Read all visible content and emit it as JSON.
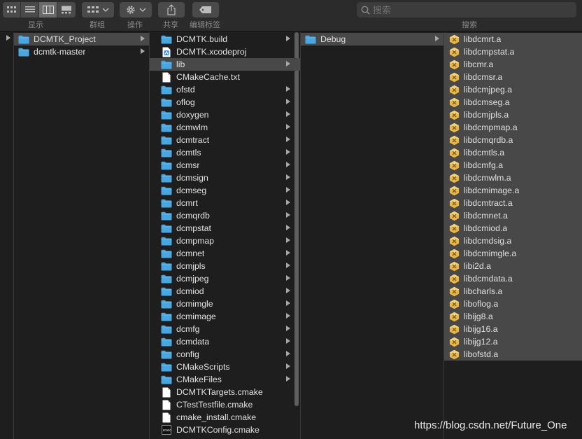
{
  "toolbar": {
    "view_label": "显示",
    "group_label": "群组",
    "action_label": "操作",
    "share_label": "共享",
    "tags_label": "编辑标签",
    "search_label": "搜索",
    "search_placeholder": "搜索"
  },
  "columns": [
    {
      "items": [
        {
          "label": "DCMTK_Project",
          "type": "folder",
          "selected": true,
          "chevron": true
        },
        {
          "label": "dcmtk-master",
          "type": "folder",
          "selected": false,
          "chevron": true
        }
      ]
    },
    {
      "items": [
        {
          "label": "DCMTK.build",
          "type": "folder",
          "selected": false,
          "chevron": true
        },
        {
          "label": "DCMTK.xcodeproj",
          "type": "xcodeproj",
          "selected": false,
          "chevron": false
        },
        {
          "label": "lib",
          "type": "folder",
          "selected": true,
          "chevron": true
        },
        {
          "label": "CMakeCache.txt",
          "type": "file",
          "selected": false,
          "chevron": false
        },
        {
          "label": "ofstd",
          "type": "folder",
          "selected": false,
          "chevron": true
        },
        {
          "label": "oflog",
          "type": "folder",
          "selected": false,
          "chevron": true
        },
        {
          "label": "doxygen",
          "type": "folder",
          "selected": false,
          "chevron": true
        },
        {
          "label": "dcmwlm",
          "type": "folder",
          "selected": false,
          "chevron": true
        },
        {
          "label": "dcmtract",
          "type": "folder",
          "selected": false,
          "chevron": true
        },
        {
          "label": "dcmtls",
          "type": "folder",
          "selected": false,
          "chevron": true
        },
        {
          "label": "dcmsr",
          "type": "folder",
          "selected": false,
          "chevron": true
        },
        {
          "label": "dcmsign",
          "type": "folder",
          "selected": false,
          "chevron": true
        },
        {
          "label": "dcmseg",
          "type": "folder",
          "selected": false,
          "chevron": true
        },
        {
          "label": "dcmrt",
          "type": "folder",
          "selected": false,
          "chevron": true
        },
        {
          "label": "dcmqrdb",
          "type": "folder",
          "selected": false,
          "chevron": true
        },
        {
          "label": "dcmpstat",
          "type": "folder",
          "selected": false,
          "chevron": true
        },
        {
          "label": "dcmpmap",
          "type": "folder",
          "selected": false,
          "chevron": true
        },
        {
          "label": "dcmnet",
          "type": "folder",
          "selected": false,
          "chevron": true
        },
        {
          "label": "dcmjpls",
          "type": "folder",
          "selected": false,
          "chevron": true
        },
        {
          "label": "dcmjpeg",
          "type": "folder",
          "selected": false,
          "chevron": true
        },
        {
          "label": "dcmiod",
          "type": "folder",
          "selected": false,
          "chevron": true
        },
        {
          "label": "dcmimgle",
          "type": "folder",
          "selected": false,
          "chevron": true
        },
        {
          "label": "dcmimage",
          "type": "folder",
          "selected": false,
          "chevron": true
        },
        {
          "label": "dcmfg",
          "type": "folder",
          "selected": false,
          "chevron": true
        },
        {
          "label": "dcmdata",
          "type": "folder",
          "selected": false,
          "chevron": true
        },
        {
          "label": "config",
          "type": "folder",
          "selected": false,
          "chevron": true
        },
        {
          "label": "CMakeScripts",
          "type": "folder",
          "selected": false,
          "chevron": true
        },
        {
          "label": "CMakeFiles",
          "type": "folder",
          "selected": false,
          "chevron": true
        },
        {
          "label": "DCMTKTargets.cmake",
          "type": "file",
          "selected": false,
          "chevron": false
        },
        {
          "label": "CTestTestfile.cmake",
          "type": "file",
          "selected": false,
          "chevron": false
        },
        {
          "label": "cmake_install.cmake",
          "type": "file",
          "selected": false,
          "chevron": false
        },
        {
          "label": "DCMTKConfig.cmake",
          "type": "exec",
          "selected": false,
          "chevron": false
        }
      ]
    },
    {
      "items": [
        {
          "label": "Debug",
          "type": "folder",
          "selected": true,
          "chevron": true
        }
      ]
    },
    {
      "items": [
        {
          "label": "libdcmrt.a",
          "type": "lib",
          "selected": true,
          "chevron": false
        },
        {
          "label": "libdcmpstat.a",
          "type": "lib",
          "selected": true,
          "chevron": false
        },
        {
          "label": "libcmr.a",
          "type": "lib",
          "selected": true,
          "chevron": false
        },
        {
          "label": "libdcmsr.a",
          "type": "lib",
          "selected": true,
          "chevron": false
        },
        {
          "label": "libdcmjpeg.a",
          "type": "lib",
          "selected": true,
          "chevron": false
        },
        {
          "label": "libdcmseg.a",
          "type": "lib",
          "selected": true,
          "chevron": false
        },
        {
          "label": "libdcmjpls.a",
          "type": "lib",
          "selected": true,
          "chevron": false
        },
        {
          "label": "libdcmpmap.a",
          "type": "lib",
          "selected": true,
          "chevron": false
        },
        {
          "label": "libdcmqrdb.a",
          "type": "lib",
          "selected": true,
          "chevron": false
        },
        {
          "label": "libdcmtls.a",
          "type": "lib",
          "selected": true,
          "chevron": false
        },
        {
          "label": "libdcmfg.a",
          "type": "lib",
          "selected": true,
          "chevron": false
        },
        {
          "label": "libdcmwlm.a",
          "type": "lib",
          "selected": true,
          "chevron": false
        },
        {
          "label": "libdcmimage.a",
          "type": "lib",
          "selected": true,
          "chevron": false
        },
        {
          "label": "libdcmtract.a",
          "type": "lib",
          "selected": true,
          "chevron": false
        },
        {
          "label": "libdcmnet.a",
          "type": "lib",
          "selected": true,
          "chevron": false
        },
        {
          "label": "libdcmiod.a",
          "type": "lib",
          "selected": true,
          "chevron": false
        },
        {
          "label": "libdcmdsig.a",
          "type": "lib",
          "selected": true,
          "chevron": false
        },
        {
          "label": "libdcmimgle.a",
          "type": "lib",
          "selected": true,
          "chevron": false
        },
        {
          "label": "libi2d.a",
          "type": "lib",
          "selected": true,
          "chevron": false
        },
        {
          "label": "libdcmdata.a",
          "type": "lib",
          "selected": true,
          "chevron": false
        },
        {
          "label": "libcharls.a",
          "type": "lib",
          "selected": true,
          "chevron": false
        },
        {
          "label": "liboflog.a",
          "type": "lib",
          "selected": true,
          "chevron": false
        },
        {
          "label": "libijg8.a",
          "type": "lib",
          "selected": true,
          "chevron": false
        },
        {
          "label": "libijg16.a",
          "type": "lib",
          "selected": true,
          "chevron": false
        },
        {
          "label": "libijg12.a",
          "type": "lib",
          "selected": true,
          "chevron": false
        },
        {
          "label": "libofstd.a",
          "type": "lib",
          "selected": true,
          "chevron": false
        }
      ]
    }
  ],
  "watermark": "https://blog.csdn.net/Future_One",
  "colors": {
    "folder": "#4aa6df",
    "folder_tab": "#6bbcef",
    "lib_icon": "#e8b64a",
    "selected_row": "#484848"
  }
}
